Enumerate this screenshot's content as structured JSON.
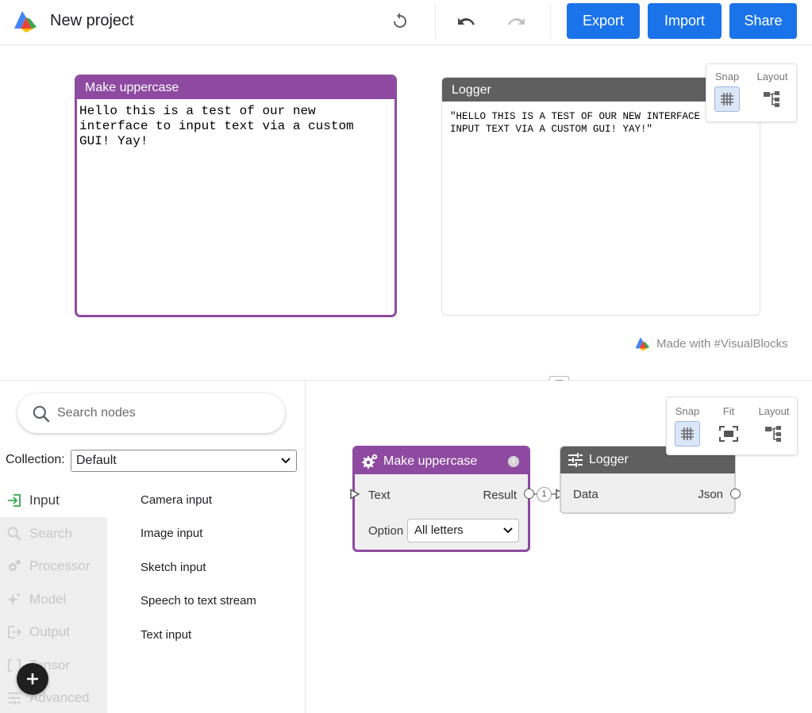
{
  "header": {
    "title": "New project",
    "buttons": {
      "export": "Export",
      "import": "Import",
      "share": "Share"
    }
  },
  "preview": {
    "upper_panel": {
      "title": "Make uppercase",
      "text": "Hello this is a test of our new interface to input text via a custom GUI! Yay!"
    },
    "logger_panel": {
      "title": "Logger",
      "text": "\"HELLO THIS IS A TEST OF OUR NEW INTERFACE INPUT TEXT VIA A CUSTOM GUI! YAY!\""
    },
    "toolbar": {
      "snap": "Snap",
      "layout": "Layout"
    },
    "made_with": "Made with #VisualBlocks"
  },
  "library": {
    "search_placeholder": "Search nodes",
    "collection_label": "Collection:",
    "collection_value": "Default",
    "categories": [
      {
        "label": "Input",
        "icon": "input-icon",
        "active": true
      },
      {
        "label": "Search",
        "icon": "search-icon"
      },
      {
        "label": "Processor",
        "icon": "processor-icon"
      },
      {
        "label": "Model",
        "icon": "sparkle-icon"
      },
      {
        "label": "Output",
        "icon": "output-icon"
      },
      {
        "label": "Tensor",
        "icon": "tensor-icon"
      },
      {
        "label": "Advanced",
        "icon": "tune-icon"
      }
    ],
    "nodes": [
      "Camera input",
      "Image input",
      "Sketch input",
      "Speech to text stream",
      "Text input"
    ]
  },
  "graph": {
    "toolbar": {
      "snap": "Snap",
      "fit": "Fit",
      "layout": "Layout"
    },
    "upper_node": {
      "title": "Make uppercase",
      "input_label": "Text",
      "output_label": "Result",
      "option_label": "Option",
      "option_value": "All letters"
    },
    "logger_node": {
      "title": "Logger",
      "input_label": "Data",
      "output_label": "Json"
    },
    "edge_count": "1"
  },
  "colors": {
    "primary": "#1a73e8",
    "purple_node": "#8e4aa0",
    "gray_node": "#5f5f5f"
  }
}
